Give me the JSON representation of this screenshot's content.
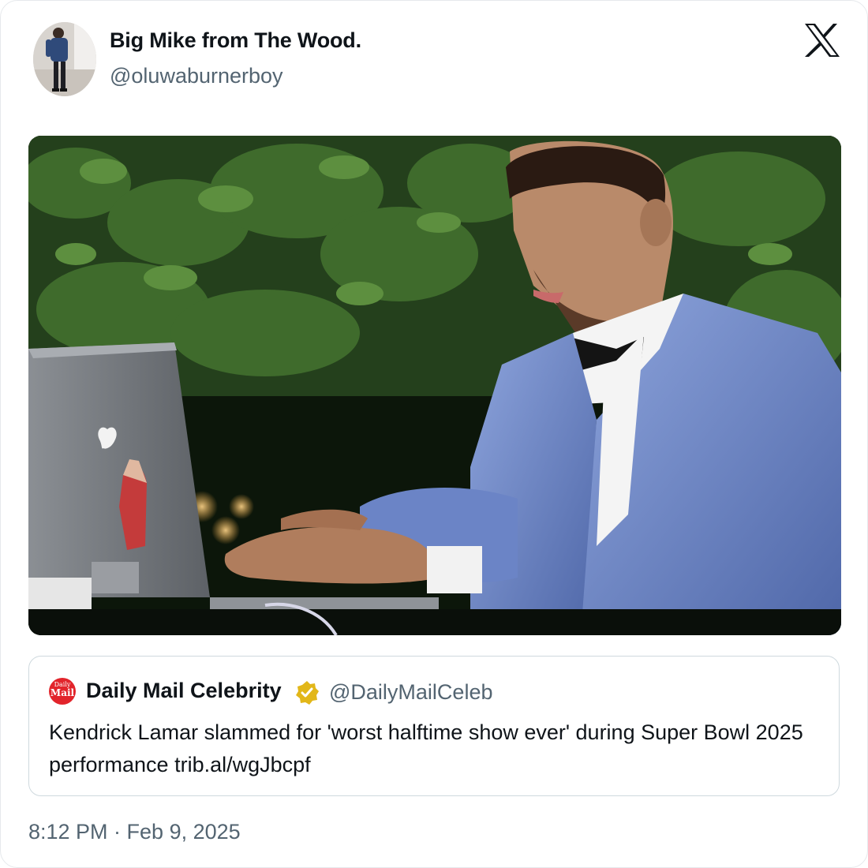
{
  "author": {
    "display_name": "Big Mike from The Wood.",
    "handle": "@oluwaburnerboy"
  },
  "brand_icon": "x-logo-icon",
  "media": {
    "description_icon": "photo"
  },
  "quoted_post": {
    "logo": {
      "line1": "Daily",
      "line2": "Mail"
    },
    "display_name": "Daily Mail Celebrity",
    "verified_badge": "gold-verified-badge-icon",
    "handle": "@DailyMailCeleb",
    "text": "Kendrick Lamar slammed for 'worst halftime show ever' during Super Bowl 2025 performance trib.al/wgJbcpf"
  },
  "timestamp": "8:12 PM · Feb 9, 2025",
  "colors": {
    "text": "#0f1419",
    "secondary": "#536471",
    "border": "#cfd9de",
    "daily_mail_red": "#e2242b",
    "gold_badge": "#e2b719"
  }
}
